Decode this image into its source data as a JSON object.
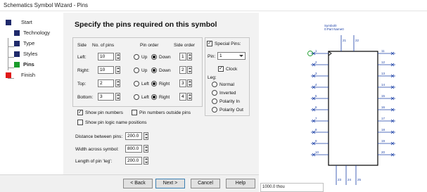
{
  "window": {
    "title": "Schematics Symbol Wizard - Pins"
  },
  "steps": [
    {
      "label": "Start",
      "color": "#1f2a6b"
    },
    {
      "label": "Technology",
      "color": "#1f2a6b"
    },
    {
      "label": "Type",
      "color": "#1f2a6b"
    },
    {
      "label": "Styles",
      "color": "#1f2a6b"
    },
    {
      "label": "Pins",
      "color": "#1a9c2b"
    },
    {
      "label": "Finish",
      "color": "#e01818"
    }
  ],
  "heading": "Specify the pins required on this symbol",
  "table": {
    "headers": {
      "side": "Side",
      "pins": "No. of pins",
      "order": "Pin order",
      "side_order": "Side order"
    },
    "rows": [
      {
        "side": "Left:",
        "pins": "10",
        "opt1": "Up",
        "opt2": "Down",
        "selected": 2,
        "order": "1"
      },
      {
        "side": "Right:",
        "pins": "10",
        "opt1": "Up",
        "opt2": "Down",
        "selected": 2,
        "order": "2"
      },
      {
        "side": "Top:",
        "pins": "2",
        "opt1": "Left",
        "opt2": "Right",
        "selected": 2,
        "order": "3"
      },
      {
        "side": "Bottom:",
        "pins": "3",
        "opt1": "Left",
        "opt2": "Right",
        "selected": 2,
        "order": "4"
      }
    ]
  },
  "special": {
    "label": "Special Pins:",
    "checked": true,
    "pin_label": "Pin:",
    "pin_value": "1",
    "clock_label": "Clock",
    "clock_checked": true,
    "leg_label": "Leg:",
    "leg_options": [
      "Normal",
      "Inverted",
      "Polarity In",
      "Polarity Out"
    ],
    "leg_selected": 0
  },
  "options": {
    "show_numbers": "Show pin numbers",
    "show_numbers_checked": true,
    "numbers_outside": "Pin numbers outside pins",
    "numbers_outside_checked": false,
    "show_logic": "Show pin logic name positions",
    "show_logic_checked": false
  },
  "dimensions": [
    {
      "label": "Distance between pins:",
      "value": "200.0"
    },
    {
      "label": "Width across symbol:",
      "value": "800.0"
    },
    {
      "label": "Length of pin 'leg':",
      "value": "200.0"
    }
  ],
  "buttons": {
    "back": "< Back",
    "next": "Next >",
    "cancel": "Cancel",
    "help": "Help"
  },
  "preview": {
    "symbol_label": "Symbol0",
    "part_label": "0:Part Name0",
    "left_pins": [
      "1",
      "2",
      "3",
      "4",
      "5",
      "6",
      "7",
      "8",
      "9",
      "10"
    ],
    "right_pins": [
      "11",
      "12",
      "13",
      "14",
      "15",
      "16",
      "17",
      "18",
      "19",
      "20"
    ],
    "top_pins": [
      "21",
      "22"
    ],
    "bottom_pins": [
      "23",
      "24",
      "25"
    ],
    "body_color": "#000000",
    "pin_color": "#1a3fa6",
    "clock_color": "#1a9c2b"
  },
  "status": "1000.0 thou"
}
